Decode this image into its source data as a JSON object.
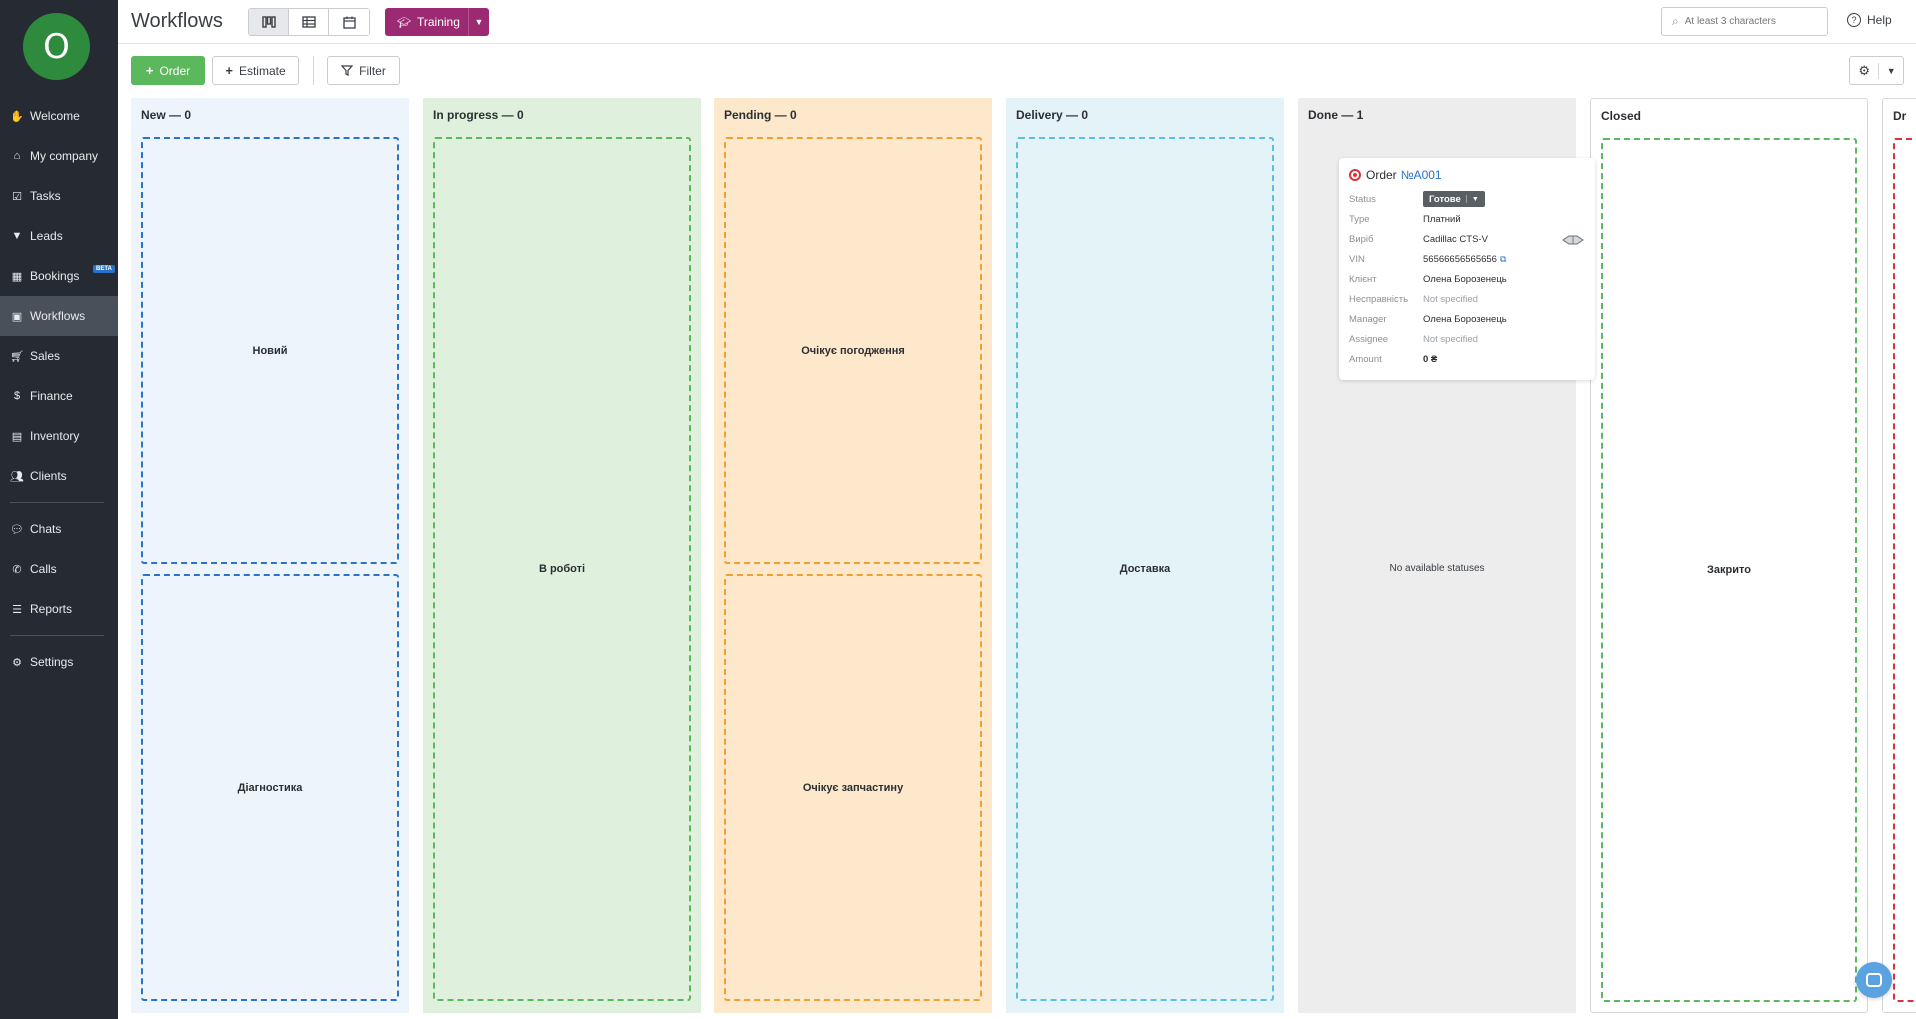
{
  "user": {
    "avatar_letter": "O",
    "avatar_color": "#2e8b3e"
  },
  "sidebar": {
    "items": [
      {
        "label": "Welcome",
        "icon": "wave-icon"
      },
      {
        "label": "My company",
        "icon": "home-icon"
      },
      {
        "label": "Tasks",
        "icon": "checklist-icon"
      },
      {
        "label": "Leads",
        "icon": "funnel-icon"
      },
      {
        "label": "Bookings",
        "icon": "calendar-icon",
        "badge": "BETA"
      },
      {
        "label": "Workflows",
        "icon": "inbox-icon",
        "active": true
      },
      {
        "label": "Sales",
        "icon": "cart-icon"
      },
      {
        "label": "Finance",
        "icon": "dollar-icon"
      },
      {
        "label": "Inventory",
        "icon": "boxes-icon"
      },
      {
        "label": "Clients",
        "icon": "users-icon"
      },
      {
        "label": "Chats",
        "icon": "chat-icon"
      },
      {
        "label": "Calls",
        "icon": "phone-icon"
      },
      {
        "label": "Reports",
        "icon": "report-icon"
      },
      {
        "label": "Settings",
        "icon": "gear-icon"
      }
    ]
  },
  "header": {
    "title": "Workflows",
    "training_label": "Training",
    "search_placeholder": "At least 3 characters",
    "help_label": "Help"
  },
  "toolbar": {
    "order_label": "Order",
    "estimate_label": "Estimate",
    "filter_label": "Filter"
  },
  "columns": [
    {
      "title": "New — 0",
      "bg": "#eef4fc",
      "border": "#2a73c8",
      "zones": [
        "Новий",
        "Діагностика"
      ]
    },
    {
      "title": "In progress — 0",
      "bg": "#dff0dc",
      "border": "#5cb85c",
      "zones": [
        "В роботі"
      ]
    },
    {
      "title": "Pending — 0",
      "bg": "#fde8cc",
      "border": "#f0a030",
      "zones": [
        "Очікує погодження",
        "Очікує запчастину"
      ]
    },
    {
      "title": "Delivery — 0",
      "bg": "#e3f3f8",
      "border": "#5bc0de",
      "zones": [
        "Доставка"
      ]
    },
    {
      "title": "Done — 1",
      "bg": "#ededed",
      "note": "No available statuses"
    },
    {
      "title": "Closed",
      "bg": "#ffffff",
      "border": "#5cb85c",
      "zones": [
        "Закрито"
      ]
    },
    {
      "title": "Dr",
      "bg": "#ffffff",
      "border": "#d9343a"
    }
  ],
  "order_card": {
    "prefix": "Order",
    "number": "№A001",
    "rows": {
      "status": {
        "key": "Status",
        "value": "Готове"
      },
      "type": {
        "key": "Type",
        "value": "Платний"
      },
      "make": {
        "key": "Виріб",
        "value": "Cadillac CTS-V"
      },
      "vin": {
        "key": "VIN",
        "value": "56566656565656"
      },
      "client": {
        "key": "Клієнт",
        "value": "Олена Борозенець"
      },
      "fault": {
        "key": "Несправність",
        "value": "Not specified"
      },
      "manager": {
        "key": "Manager",
        "value": "Олена Борозенець"
      },
      "assignee": {
        "key": "Assignee",
        "value": "Not specified"
      },
      "amount": {
        "key": "Amount",
        "value": "0 ₴"
      }
    }
  },
  "colors": {
    "accent_green": "#5cb85c",
    "training": "#9c2a73",
    "link": "#2a73c8"
  }
}
